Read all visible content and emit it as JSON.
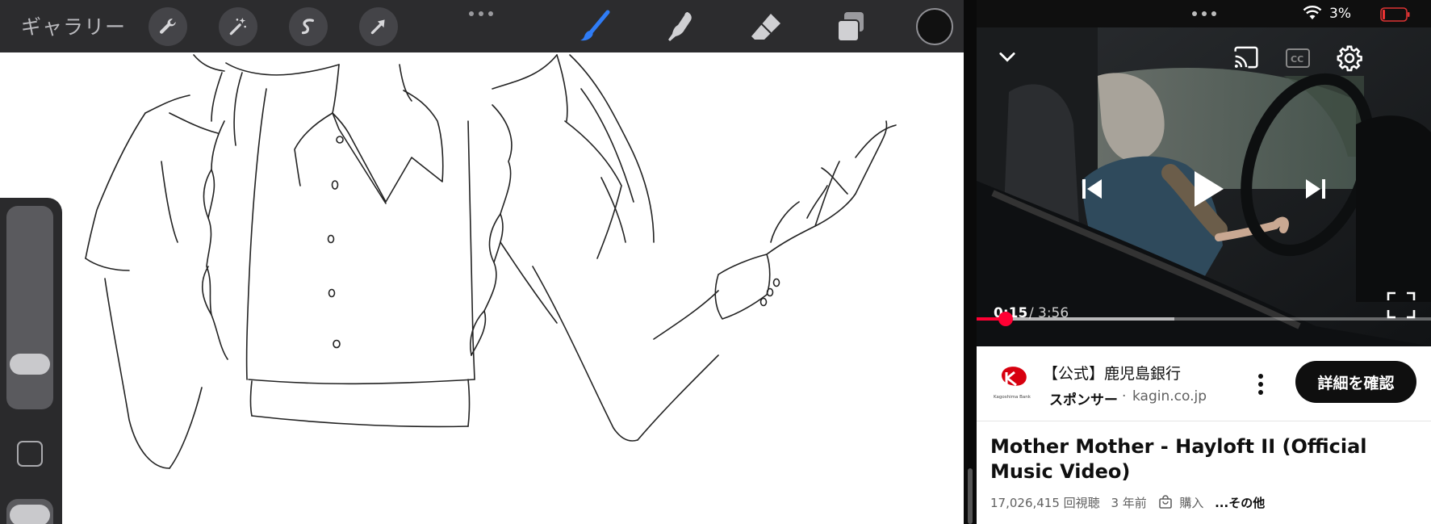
{
  "left_app": {
    "gallery_label": "ギャラリー",
    "toolbar_tools": [
      "wrench-icon",
      "magic-wand-icon",
      "selection-icon",
      "transform-arrow-icon"
    ],
    "right_tools": [
      "brush-icon",
      "smudge-icon",
      "eraser-icon",
      "layers-icon"
    ],
    "active_tool_color": "#2f7cf6",
    "current_color": "#111111"
  },
  "right_app": {
    "status": {
      "battery_percent": "3%"
    },
    "player": {
      "time_current": "0:15",
      "time_separator": "/",
      "time_total": "3:56",
      "progress_fraction": 0.064
    },
    "ad": {
      "title": "【公式】鹿児島銀行",
      "sponsor_label": "スポンサー",
      "separator": "·",
      "domain": "kagin.co.jp",
      "logo_caption": "Kagoshima Bank",
      "cta_label": "詳細を確認",
      "brand_color": "#d7000f"
    },
    "video": {
      "title": "Mother Mother - Hayloft II (Official Music Video)",
      "views": "17,026,415 回視聴",
      "age": "3 年前",
      "purchase_label": "購入",
      "more_label": "...その他"
    }
  }
}
